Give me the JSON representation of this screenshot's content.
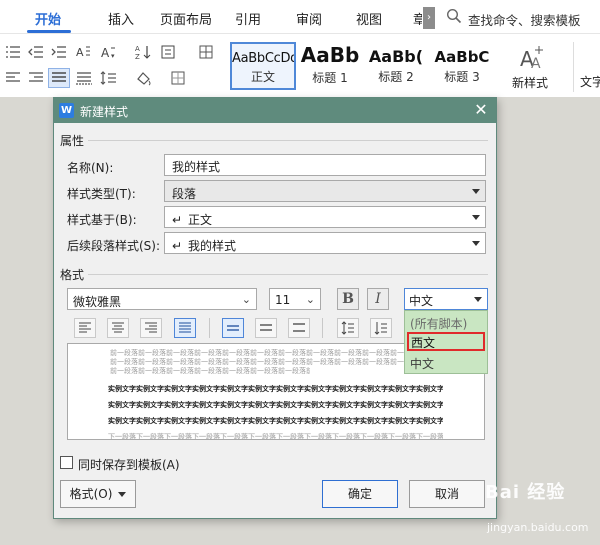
{
  "ribbon": {
    "tabs": [
      "开始",
      "插入",
      "页面布局",
      "引用",
      "审阅",
      "视图",
      "章"
    ],
    "active_tab": "开始",
    "search_placeholder": "查找命令、搜索模板",
    "styles": [
      {
        "sample": "AaBbCcDd",
        "name": "正文"
      },
      {
        "sample": "AaBb",
        "name": "标题 1"
      },
      {
        "sample": "AaBb(",
        "name": "标题 2"
      },
      {
        "sample": "AaBbC",
        "name": "标题 3"
      }
    ],
    "new_style_label": "新样式",
    "text_tool_label": "文字"
  },
  "dialog": {
    "title": "新建样式",
    "properties_section": "属性",
    "name_label": "名称(N):",
    "name_value": "我的样式",
    "style_type_label": "样式类型(T):",
    "style_type_value": "段落",
    "based_on_label": "样式基于(B):",
    "based_on_value": "正文",
    "next_style_label": "后续段落样式(S):",
    "next_style_value": "我的样式",
    "format_section": "格式",
    "font_name": "微软雅黑",
    "font_size": "11",
    "bold_label": "B",
    "italic_label": "I",
    "language_value": "中文",
    "language_options": [
      {
        "label": "(所有脚本)",
        "state": "disabled"
      },
      {
        "label": "西文",
        "state": "highlighted"
      },
      {
        "label": "中文",
        "state": "current"
      }
    ],
    "preview_prev_line": "前一段落前一段落前一段落前一段落前一段落前一段落前一段落前一段落前一段落前一段落前一段落前一段落",
    "preview_sample_line": "实例文字实例文字实例文字实例文字实例文字实例文字实例文字实例文字实例文字实例文字实例文字实例文字",
    "preview_next_line": "下一段落下一段落下一段落下一段落下一段落下一段落下一段落下一段落下一段落下一段落下一段落下一段落",
    "save_template_label": "同时保存到模板(A)",
    "format_button": "格式(O)",
    "ok_button": "确定",
    "cancel_button": "取消"
  },
  "watermark": {
    "brand": "Bai 经验",
    "url": "jingyan.baidu.com"
  },
  "colors": {
    "accent": "#2c6ed6",
    "dialog_title_bar": "#5f8b7d",
    "dropdown_bg": "#c9e6c2",
    "highlight_border": "#e02b2b"
  }
}
